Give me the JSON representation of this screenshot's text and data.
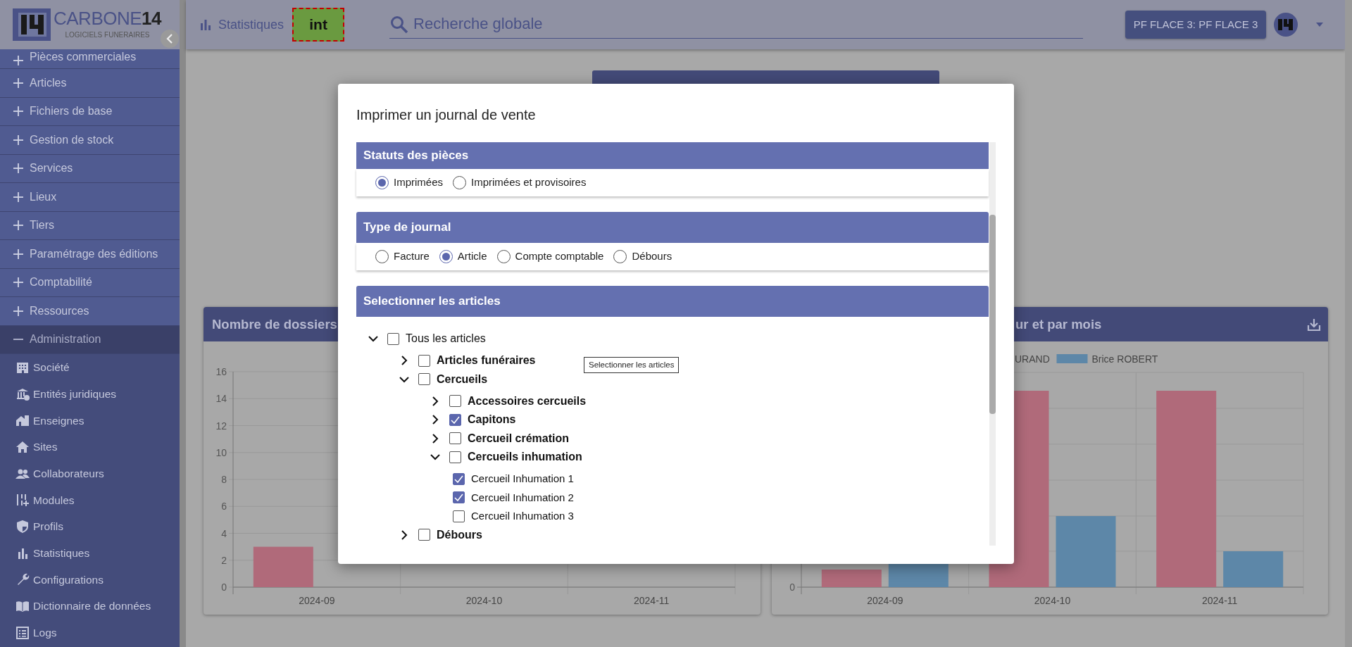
{
  "sidebar": {
    "brand": "CARBONE**14**",
    "tagline": "LOGICIELS FUNERAIRES",
    "items": [
      {
        "label": "Pièces commerciales",
        "expanded": false
      },
      {
        "label": "Articles",
        "expanded": false
      },
      {
        "label": "Fichiers de base",
        "expanded": false
      },
      {
        "label": "Gestion de stock",
        "expanded": false
      },
      {
        "label": "Services",
        "expanded": false
      },
      {
        "label": "Lieux",
        "expanded": false
      },
      {
        "label": "Tiers",
        "expanded": false
      },
      {
        "label": "Paramétrage des éditions",
        "expanded": false
      },
      {
        "label": "Comptabilité",
        "expanded": false
      },
      {
        "label": "Ressources",
        "expanded": false
      },
      {
        "label": "Administration",
        "expanded": true,
        "children": [
          {
            "label": "Société"
          },
          {
            "label": "Entités juridiques"
          },
          {
            "label": "Enseignes"
          },
          {
            "label": "Sites"
          },
          {
            "label": "Collaborateurs"
          },
          {
            "label": "Modules"
          },
          {
            "label": "Profils"
          },
          {
            "label": "Statistiques"
          },
          {
            "label": "Configurations"
          },
          {
            "label": "Dictionnaire de données"
          },
          {
            "label": "Logs"
          }
        ]
      }
    ]
  },
  "header": {
    "page_title": "Statistiques",
    "env_badge": "int",
    "search": {
      "placeholder": "Recherche globale"
    },
    "account_button": "PF FLACE 3: PF FLACE 3"
  },
  "background_charts": [
    {
      "title": "Nombre de dossiers",
      "chart_data": {
        "type": "bar",
        "grid": true,
        "categories": [
          "2024-09",
          "2024-10",
          "2024-11"
        ],
        "ylim": [
          0,
          16
        ],
        "yticks": [
          0,
          2,
          4,
          6,
          8,
          10,
          12,
          14,
          16
        ],
        "series": [
          {
            "color": "#b06a7a",
            "values": [
              3,
              null,
              null
            ]
          },
          {
            "color": "#5d87a8",
            "values": [
              0,
              0,
              null
            ]
          }
        ]
      }
    },
    {
      "title": "ur et par mois",
      "legend": [
        {
          "label": "URAND"
        },
        {
          "label": "Brice ROBERT",
          "color": "#5d87a8"
        }
      ],
      "x_labels": [
        "2024-09",
        "2024-10",
        "2024-11"
      ],
      "y_labels": [
        "0"
      ]
    }
  ],
  "dialog": {
    "title": "Imprimer un journal de vente",
    "tooltip": "Selectionner les articles",
    "sections": [
      {
        "kind": "radios",
        "title": "Statuts des pièces",
        "options": [
          {
            "label": "Imprimées",
            "selected": true
          },
          {
            "label": "Imprimées et provisoires",
            "selected": false
          }
        ]
      },
      {
        "kind": "radios",
        "title": "Type de journal",
        "options": [
          {
            "label": "Facture",
            "selected": false
          },
          {
            "label": "Article",
            "selected": true
          },
          {
            "label": "Compte comptable",
            "selected": false
          },
          {
            "label": "Débours",
            "selected": false
          }
        ]
      },
      {
        "kind": "tree",
        "title": "Selectionner les articles",
        "tree": [
          {
            "label": "Tous les articles",
            "checked": false,
            "expanded": true,
            "children": [
              {
                "label": "Articles funéraires",
                "checked": false,
                "expanded": false
              },
              {
                "label": "Cercueils",
                "checked": false,
                "expanded": true,
                "children": [
                  {
                    "label": "Accessoires cercueils",
                    "checked": false,
                    "expanded": false
                  },
                  {
                    "label": "Capitons",
                    "checked": true,
                    "expanded": false
                  },
                  {
                    "label": "Cercueil crémation",
                    "checked": false,
                    "expanded": false
                  },
                  {
                    "label": "Cercueils inhumation",
                    "checked": false,
                    "expanded": true,
                    "children": [
                      {
                        "label": "Cercueil Inhumation 1",
                        "checked": true
                      },
                      {
                        "label": "Cercueil Inhumation 2",
                        "checked": true
                      },
                      {
                        "label": "Cercueil Inhumation 3",
                        "checked": false
                      }
                    ]
                  }
                ]
              },
              {
                "label": "Débours",
                "checked": false,
                "expanded": false
              }
            ]
          }
        ]
      }
    ]
  }
}
